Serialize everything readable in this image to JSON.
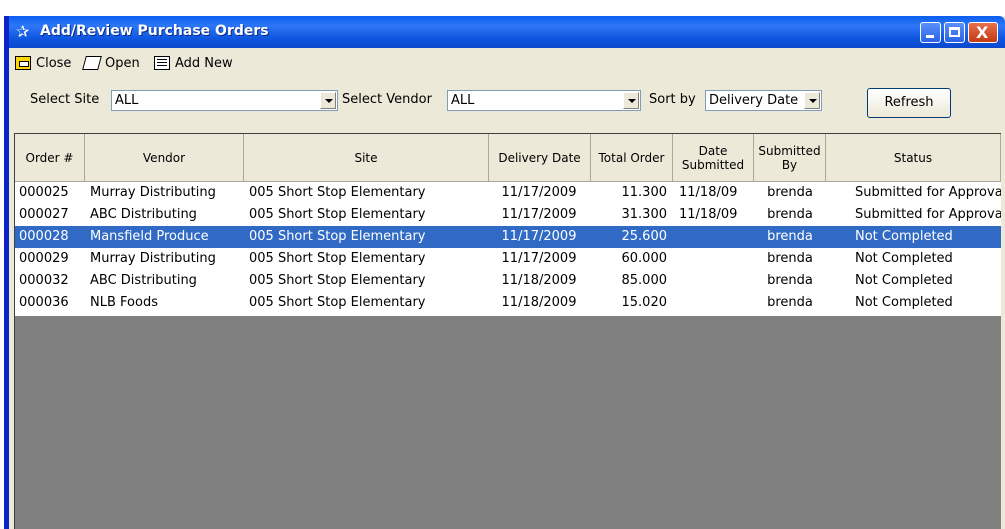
{
  "window": {
    "title": "Add/Review Purchase Orders",
    "controls": {
      "minimize": "minimize",
      "maximize": "maximize",
      "close": "X"
    }
  },
  "toolbar": {
    "close_label": "Close",
    "open_label": "Open",
    "add_new_label": "Add New"
  },
  "filters": {
    "site_label": "Select Site",
    "site_value": "ALL",
    "vendor_label": "Select Vendor",
    "vendor_value": "ALL",
    "sort_label": "Sort by",
    "sort_value": "Delivery Date",
    "refresh_label": "Refresh"
  },
  "grid": {
    "columns": [
      "Order #",
      "Vendor",
      "Site",
      "Delivery Date",
      "Total Order",
      "Date Submitted",
      "Submitted By",
      "Status"
    ],
    "rows": [
      {
        "order": "000025",
        "vendor": "Murray Distributing",
        "site": "005 Short Stop Elementary",
        "delivery": "11/17/2009",
        "total": "11.300",
        "submitted": "11/18/09",
        "by": "brenda",
        "status": "Submitted for Approval",
        "selected": false
      },
      {
        "order": "000027",
        "vendor": "ABC Distributing",
        "site": "005 Short Stop Elementary",
        "delivery": "11/17/2009",
        "total": "31.300",
        "submitted": "11/18/09",
        "by": "brenda",
        "status": "Submitted for Approval",
        "selected": false
      },
      {
        "order": "000028",
        "vendor": "Mansfield Produce",
        "site": "005 Short Stop Elementary",
        "delivery": "11/17/2009",
        "total": "25.600",
        "submitted": "",
        "by": "brenda",
        "status": "Not Completed",
        "selected": true
      },
      {
        "order": "000029",
        "vendor": "Murray Distributing",
        "site": "005 Short Stop Elementary",
        "delivery": "11/17/2009",
        "total": "60.000",
        "submitted": "",
        "by": "brenda",
        "status": "Not Completed",
        "selected": false
      },
      {
        "order": "000032",
        "vendor": "ABC Distributing",
        "site": "005 Short Stop Elementary",
        "delivery": "11/18/2009",
        "total": "85.000",
        "submitted": "",
        "by": "brenda",
        "status": "Not Completed",
        "selected": false
      },
      {
        "order": "000036",
        "vendor": "NLB Foods",
        "site": "005 Short Stop Elementary",
        "delivery": "11/18/2009",
        "total": "15.020",
        "submitted": "",
        "by": "brenda",
        "status": "Not Completed",
        "selected": false
      }
    ]
  },
  "colors": {
    "titlebar": "#0a5ef0",
    "selection": "#316ac5",
    "grid_empty": "#808080",
    "chrome": "#ece9d8"
  }
}
